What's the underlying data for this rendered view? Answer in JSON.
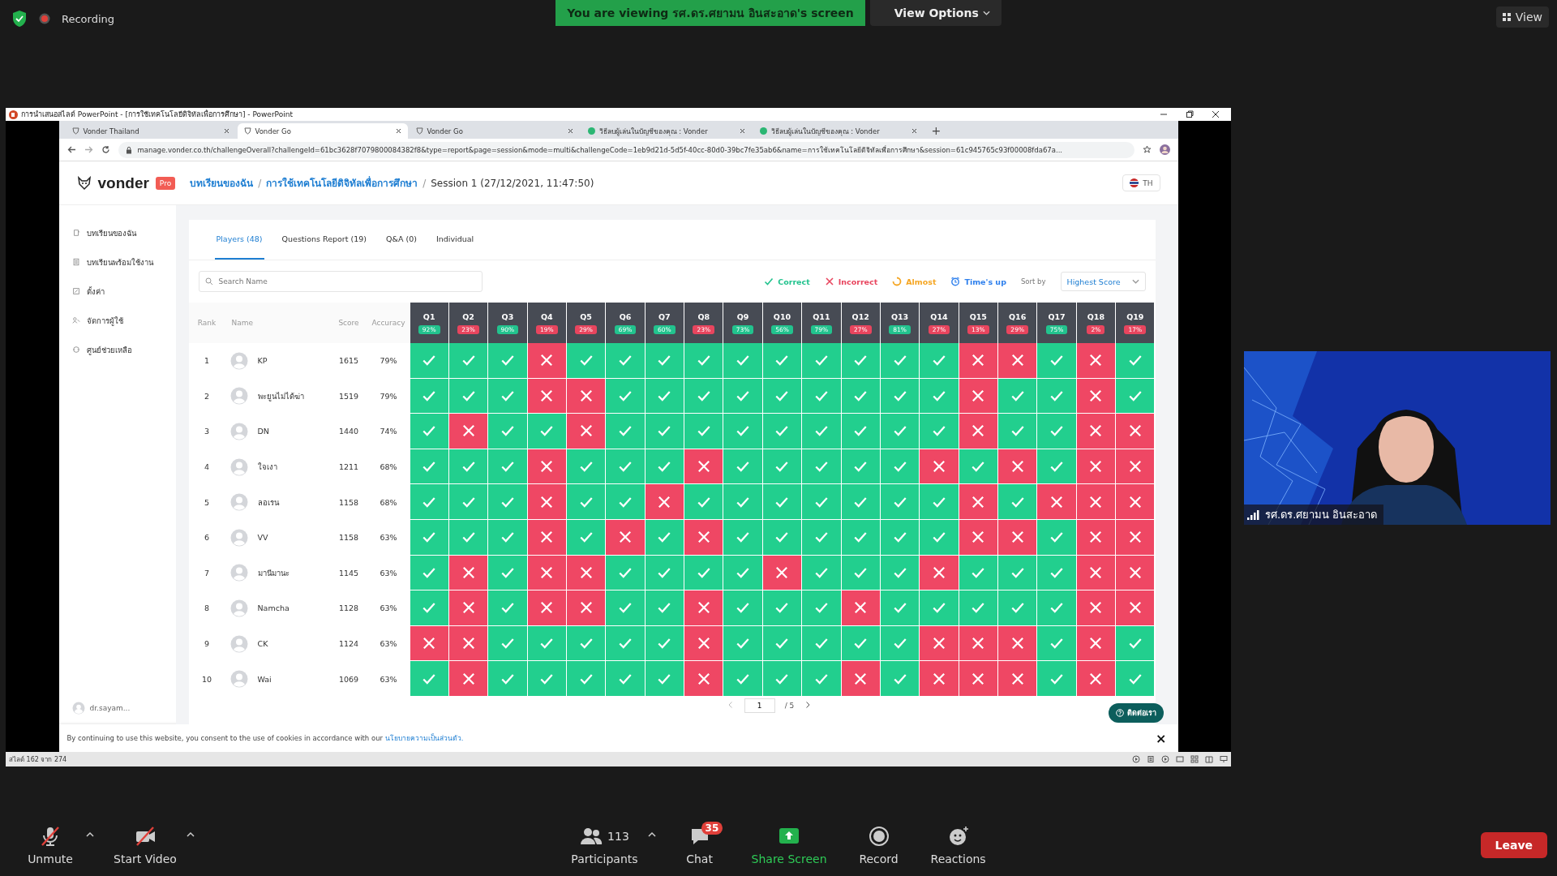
{
  "zoom": {
    "recording_label": "Recording",
    "share_banner": "You are viewing รศ.ดร.ศยามน อินสะอาด's screen",
    "view_options": "View Options",
    "view_button": "View"
  },
  "powerpoint": {
    "title": "การนำเสนอสไลด์ PowerPoint - [การใช้เทคโนโลยีดิจิทัลเพื่อการศึกษา] - PowerPoint",
    "status": "สไลด์ 162 จาก 274"
  },
  "browser": {
    "tabs": [
      {
        "title": "Vonder Thailand",
        "selected": false,
        "kind": "vonder"
      },
      {
        "title": "Vonder Go",
        "selected": true,
        "kind": "vonder"
      },
      {
        "title": "Vonder Go",
        "selected": false,
        "kind": "vonder"
      },
      {
        "title": "วิธีลบผู้เล่นในบัญชีของคุณ : Vonder",
        "selected": false,
        "kind": "help"
      },
      {
        "title": "วิธีลบผู้เล่นในบัญชีของคุณ : Vonder",
        "selected": false,
        "kind": "help"
      }
    ],
    "new_tab": "+",
    "url": "manage.vonder.co.th/challengeOverall?challengeId=61bc3628f7079800084382f8&type=report&page=session&mode=multi&challengeCode=1eb9d21d-5d5f-40cc-80d0-39bc7fe35ab6&name=การใช้เทคโนโลยีดิจิทัลเพื่อการศึกษา&session=61c945765c93f00008fda67a..."
  },
  "app": {
    "brand": "vonder",
    "plan_badge": "Pro",
    "breadcrumb": [
      {
        "label": "บทเรียนของฉัน",
        "link": true
      },
      {
        "separator": "/",
        "label": "การใช้เทคโนโลยีดิจิทัลเพื่อการศึกษา",
        "link": true
      },
      {
        "separator": "/",
        "label": "Session 1 (27/12/2021, 11:47:50)",
        "link": false
      }
    ],
    "language": "TH",
    "sidebar": {
      "items": [
        "บทเรียนของฉัน",
        "บทเรียนพร้อมใช้งาน",
        "ตั้งค่า",
        "จัดการผู้ใช้",
        "ศูนย์ช่วยเหลือ"
      ],
      "user": "dr.sayam..."
    },
    "tabs": [
      {
        "label": "Players (48)",
        "selected": true
      },
      {
        "label": "Questions Report (19)",
        "selected": false
      },
      {
        "label": "Q&A (0)",
        "selected": false
      },
      {
        "label": "Individual",
        "selected": false
      }
    ],
    "search": {
      "placeholder": "Search Name"
    },
    "legend": [
      {
        "label": "Correct",
        "kind": "correct"
      },
      {
        "label": "Incorrect",
        "kind": "incorrect"
      },
      {
        "label": "Almost",
        "kind": "almost"
      },
      {
        "label": "Time's up",
        "kind": "timesup"
      }
    ],
    "sort": {
      "label": "Sort by",
      "value": "Highest Score"
    },
    "table": {
      "columns": [
        "Rank",
        "Name",
        "Score",
        "Accuracy"
      ],
      "questions": [
        {
          "label": "Q1",
          "percent": "92%",
          "color": "#22c38e"
        },
        {
          "label": "Q2",
          "percent": "23%",
          "color": "#e8455e"
        },
        {
          "label": "Q3",
          "percent": "90%",
          "color": "#22c38e"
        },
        {
          "label": "Q4",
          "percent": "19%",
          "color": "#e8455e"
        },
        {
          "label": "Q5",
          "percent": "29%",
          "color": "#e8455e"
        },
        {
          "label": "Q6",
          "percent": "69%",
          "color": "#22c38e"
        },
        {
          "label": "Q7",
          "percent": "60%",
          "color": "#22c38e"
        },
        {
          "label": "Q8",
          "percent": "23%",
          "color": "#e8455e"
        },
        {
          "label": "Q9",
          "percent": "73%",
          "color": "#22c38e"
        },
        {
          "label": "Q10",
          "percent": "56%",
          "color": "#22c38e"
        },
        {
          "label": "Q11",
          "percent": "79%",
          "color": "#22c38e"
        },
        {
          "label": "Q12",
          "percent": "27%",
          "color": "#e8455e"
        },
        {
          "label": "Q13",
          "percent": "81%",
          "color": "#22c38e"
        },
        {
          "label": "Q14",
          "percent": "27%",
          "color": "#e8455e"
        },
        {
          "label": "Q15",
          "percent": "13%",
          "color": "#e8455e"
        },
        {
          "label": "Q16",
          "percent": "29%",
          "color": "#e8455e"
        },
        {
          "label": "Q17",
          "percent": "75%",
          "color": "#22c38e"
        },
        {
          "label": "Q18",
          "percent": "2%",
          "color": "#e8455e"
        },
        {
          "label": "Q19",
          "percent": "17%",
          "color": "#e8455e"
        }
      ],
      "rows": [
        {
          "rank": "1",
          "name": "KP",
          "score": "1615",
          "accuracy": "79%",
          "correct": [
            true,
            true,
            true,
            false,
            true,
            true,
            true,
            true,
            true,
            true,
            true,
            true,
            true,
            true,
            false,
            false,
            true,
            false,
            true
          ]
        },
        {
          "rank": "2",
          "name": "พะยูนไม่ได้ฆ่า",
          "score": "1519",
          "accuracy": "79%",
          "correct": [
            true,
            true,
            true,
            false,
            false,
            true,
            true,
            true,
            true,
            true,
            true,
            true,
            true,
            true,
            false,
            true,
            true,
            false,
            true
          ]
        },
        {
          "rank": "3",
          "name": "DN",
          "score": "1440",
          "accuracy": "74%",
          "correct": [
            true,
            false,
            true,
            true,
            false,
            true,
            true,
            true,
            true,
            true,
            true,
            true,
            true,
            true,
            false,
            true,
            true,
            false,
            false
          ]
        },
        {
          "rank": "4",
          "name": "ใจเงา",
          "score": "1211",
          "accuracy": "68%",
          "correct": [
            true,
            true,
            true,
            false,
            true,
            true,
            true,
            false,
            true,
            true,
            true,
            true,
            true,
            false,
            true,
            false,
            true,
            false,
            false
          ]
        },
        {
          "rank": "5",
          "name": "ลอเรน",
          "score": "1158",
          "accuracy": "68%",
          "correct": [
            true,
            true,
            true,
            false,
            true,
            true,
            false,
            true,
            true,
            true,
            true,
            true,
            true,
            true,
            false,
            true,
            false,
            false,
            false
          ]
        },
        {
          "rank": "6",
          "name": "VV",
          "score": "1158",
          "accuracy": "63%",
          "correct": [
            true,
            true,
            true,
            false,
            true,
            false,
            true,
            false,
            true,
            true,
            true,
            true,
            true,
            true,
            false,
            false,
            true,
            false,
            false
          ]
        },
        {
          "rank": "7",
          "name": "มานีมานะ",
          "score": "1145",
          "accuracy": "63%",
          "correct": [
            true,
            false,
            true,
            false,
            false,
            true,
            true,
            true,
            true,
            false,
            true,
            true,
            true,
            false,
            true,
            true,
            true,
            false,
            false
          ]
        },
        {
          "rank": "8",
          "name": "Namcha",
          "score": "1128",
          "accuracy": "63%",
          "correct": [
            true,
            false,
            true,
            false,
            false,
            true,
            true,
            false,
            true,
            true,
            true,
            false,
            true,
            true,
            true,
            true,
            true,
            false,
            false
          ]
        },
        {
          "rank": "9",
          "name": "CK",
          "score": "1124",
          "accuracy": "63%",
          "correct": [
            false,
            false,
            true,
            true,
            true,
            true,
            true,
            false,
            true,
            true,
            true,
            true,
            true,
            false,
            false,
            false,
            true,
            false,
            true
          ]
        },
        {
          "rank": "10",
          "name": "Wai",
          "score": "1069",
          "accuracy": "63%",
          "correct": [
            true,
            false,
            true,
            true,
            true,
            true,
            true,
            false,
            true,
            true,
            true,
            false,
            true,
            false,
            false,
            false,
            true,
            false,
            true
          ]
        }
      ]
    },
    "pagination": {
      "page": "1",
      "total": "/ 5"
    },
    "help_button": "ติดต่อเรา",
    "cookie": {
      "text": "By continuing to use this website, you consent to the use of cookies in accordance with our ",
      "link": "นโยบายความเป็นส่วนตัว.",
      "close": "×"
    }
  },
  "video": {
    "name": "รศ.ดร.ศยามน อินสะอาด"
  },
  "toolbar": {
    "left": [
      {
        "label": "Unmute",
        "kind": "mic"
      },
      {
        "label": "Start Video",
        "kind": "video"
      }
    ],
    "center": [
      {
        "label": "Participants",
        "kind": "participants",
        "count": "113"
      },
      {
        "label": "Chat",
        "kind": "chat",
        "badge": "35"
      },
      {
        "label": "Share Screen",
        "kind": "share"
      },
      {
        "label": "Record",
        "kind": "record"
      },
      {
        "label": "Reactions",
        "kind": "reactions"
      }
    ],
    "leave": "Leave"
  }
}
